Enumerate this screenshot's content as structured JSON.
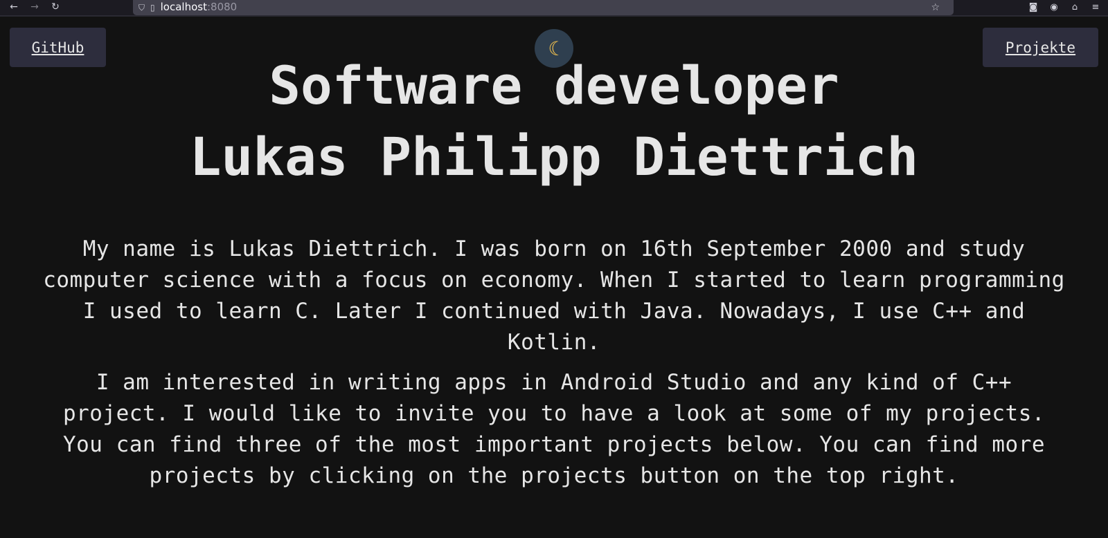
{
  "browser": {
    "url_host": "localhost",
    "url_port": ":8080"
  },
  "nav": {
    "github_label": "GitHub",
    "projects_label": "Projekte",
    "theme_toggle_icon": "moon-icon"
  },
  "header": {
    "line1": "Software developer",
    "line2": "Lukas Philipp Diettrich"
  },
  "bio": {
    "paragraph1": "My name is Lukas Diettrich. I was born on 16th September 2000 and study computer science with a focus on economy. When I started to learn programming I used to learn C. Later I continued with Java. Nowadays, I use C++ and Kotlin.",
    "paragraph2": "I am interested in writing apps in Android Studio and any kind of C++ project. I would like to invite you to have a look at some of my projects. You can find three of the most important projects below. You can find more projects by clicking on the projects button on the top right."
  },
  "colors": {
    "background": "#121212",
    "button_bg": "#2d2d3d",
    "text": "#e6e6e6",
    "toggle_bg": "#2f3f4f",
    "moon": "#f2c14e"
  }
}
